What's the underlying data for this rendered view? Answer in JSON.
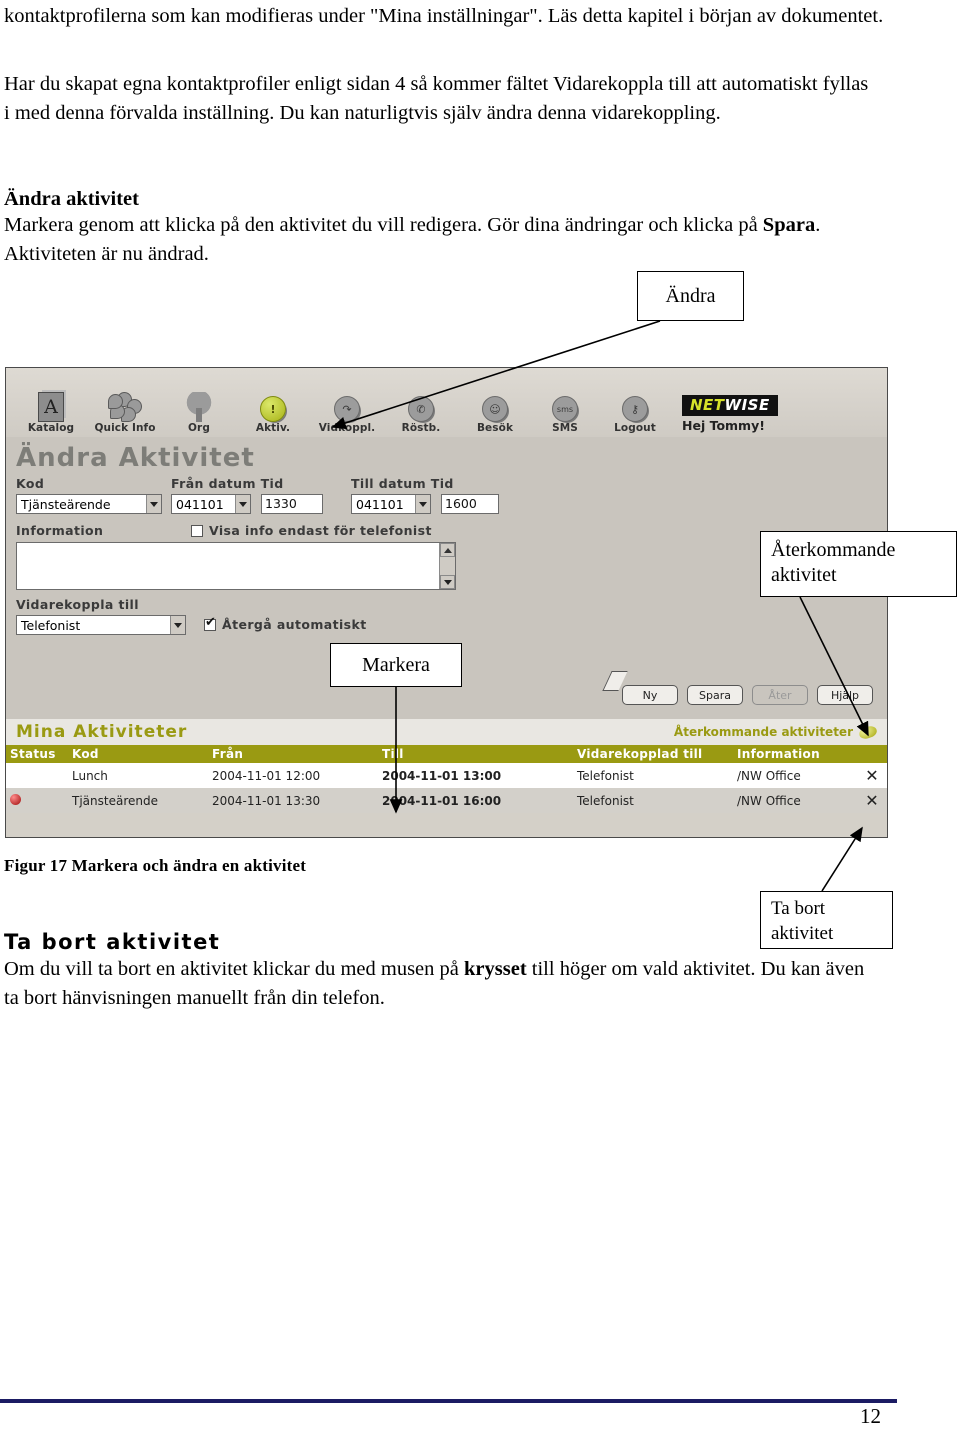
{
  "document": {
    "paragraphs": {
      "intro": "kontaktprofilerna som kan modifieras under \"Mina inställningar\". Läs detta kapitel i början av dokumentet.",
      "profile": "Har du skapat egna kontaktprofiler enligt sidan 4 så kommer fältet Vidarekoppla till att automatiskt fyllas i med denna förvalda inställning. Du kan naturligtvis själv ändra denna vidarekoppling.",
      "andra_heading": "Ändra aktivitet",
      "andra_body_1": "Markera genom att klicka på den aktivitet du vill redigera. Gör dina ändringar och klicka på ",
      "andra_body_bold": "Spara",
      "andra_body_2": ". Aktiviteten är nu ändrad.",
      "figure_caption": "Figur 17  Markera och ändra en aktivitet",
      "tabort_heading": "Ta bort aktivitet",
      "tabort_body_1": "Om du vill ta bort en aktivitet klickar du med musen på ",
      "tabort_body_bold": "krysset",
      "tabort_body_2": " till höger om vald aktivitet. Du kan även ta bort hänvisningen manuellt från din telefon."
    },
    "page_number": "12",
    "footer_rule_color": "#1b1b63"
  },
  "callouts": {
    "andra": "Ändra",
    "aterkommande": "Återkommande aktivitet",
    "markera": "Markera",
    "tabort": "Ta bort aktivitet"
  },
  "app": {
    "toolbar": {
      "items": [
        {
          "label": "Katalog",
          "icon": "book-icon"
        },
        {
          "label": "Quick Info",
          "icon": "flower-icon"
        },
        {
          "label": "Org",
          "icon": "tree-icon"
        },
        {
          "label": "Aktiv.",
          "icon": "alert-circle-icon"
        },
        {
          "label": "Vidkoppl.",
          "icon": "forward-call-icon"
        },
        {
          "label": "Röstb.",
          "icon": "voicemail-icon"
        },
        {
          "label": "Besök",
          "icon": "visitor-face-icon"
        },
        {
          "label": "SMS",
          "icon": "sms-icon"
        },
        {
          "label": "Logout",
          "icon": "key-icon"
        }
      ],
      "logo_first": "NET",
      "logo_second": "WISE",
      "greeting": "Hej Tommy!",
      "logo_accent": "#d6e22a"
    },
    "form": {
      "title": "Ändra Aktivitet",
      "labels": {
        "kod": "Kod",
        "fran_datum_tid": "Från datum Tid",
        "till_datum_tid": "Till datum Tid",
        "information": "Information",
        "visa_info": "Visa info endast för telefonist",
        "vidarekoppla": "Vidarekoppla till",
        "aterga": "Återgå automatiskt"
      },
      "values": {
        "kod": "Tjänsteärende",
        "fran_datum": "041101",
        "fran_tid": "1330",
        "till_datum": "041101",
        "till_tid": "1600",
        "information": "",
        "visa_info_checked": false,
        "vidarekoppla": "Telefonist",
        "aterga_checked": true
      },
      "buttons": [
        {
          "label": "Ny",
          "disabled": false
        },
        {
          "label": "Spara",
          "disabled": false
        },
        {
          "label": "Åter",
          "disabled": true
        },
        {
          "label": "Hjälp",
          "disabled": false
        }
      ]
    },
    "activities": {
      "title": "Mina Aktiviteter",
      "recurring_link": "Återkommande aktiviteter",
      "columns": [
        "Status",
        "Kod",
        "Från",
        "Till",
        "Vidarekopplad till",
        "Information",
        ""
      ],
      "rows": [
        {
          "status": "",
          "kod": "Lunch",
          "fran": "2004-11-01 12:00",
          "till": "2004-11-01 13:00",
          "vidarekopplad": "Telefonist",
          "information": "/NW Office",
          "delete": "✕",
          "selected": false
        },
        {
          "status": "red-dot",
          "kod": "Tjänsteärende",
          "fran": "2004-11-01 13:30",
          "till": "2004-11-01 16:00",
          "vidarekopplad": "Telefonist",
          "information": "/NW Office",
          "delete": "✕",
          "selected": true
        }
      ],
      "header_color": "#9a9a12",
      "till_color": "#7e1010"
    }
  }
}
